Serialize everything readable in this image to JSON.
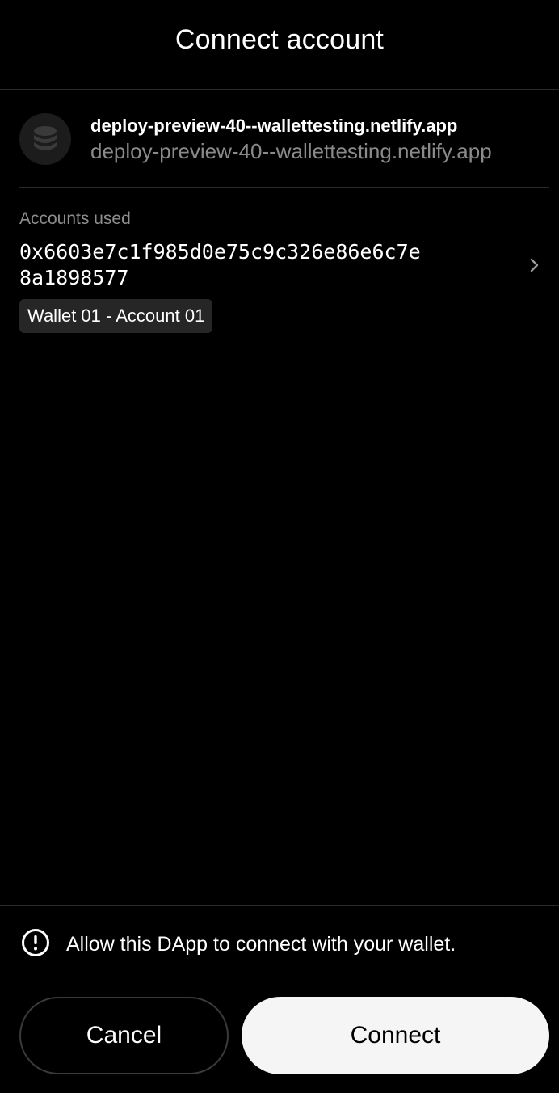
{
  "header": {
    "title": "Connect account"
  },
  "dapp": {
    "icon": "database-icon",
    "name": "deploy-preview-40--wallettesting.netlify.app",
    "url": "deploy-preview-40--wallettesting.netlify.app"
  },
  "accounts": {
    "label": "Accounts used",
    "address": "0x6603e7c1f985d0e75c9c326e86e6c7e8a1898577",
    "account_name": "Wallet 01 - Account 01",
    "chevron_icon": "chevron-right-icon"
  },
  "notice": {
    "icon": "info-circle-icon",
    "text": "Allow this DApp to connect with your wallet."
  },
  "buttons": {
    "cancel_label": "Cancel",
    "connect_label": "Connect"
  },
  "colors": {
    "background": "#000000",
    "muted_text": "#8a8a8a",
    "badge_bg": "#262626",
    "connect_bg": "#f5f5f5"
  }
}
